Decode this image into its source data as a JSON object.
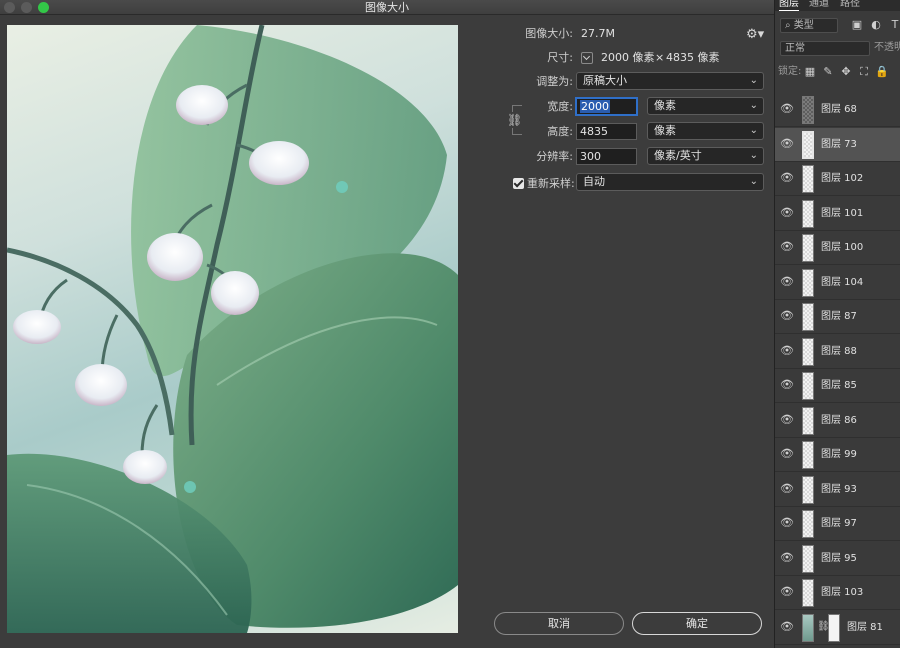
{
  "window": {
    "title": "图像大小"
  },
  "info": {
    "size_label": "图像大小:",
    "size_value": "27.7M",
    "dimensions_label": "尺寸:",
    "dimensions_w": "2000 像素",
    "dimensions_x": "×",
    "dimensions_h": "4835 像素"
  },
  "fit_to": {
    "label": "调整为:",
    "value": "原稿大小"
  },
  "width": {
    "label": "宽度:",
    "value": "2000",
    "unit": "像素"
  },
  "height": {
    "label": "高度:",
    "value": "4835",
    "unit": "像素"
  },
  "resolution": {
    "label": "分辨率:",
    "value": "300",
    "unit": "像素/英寸"
  },
  "resample": {
    "label": "重新采样:",
    "checked": true,
    "value": "自动"
  },
  "buttons": {
    "cancel": "取消",
    "ok": "确定"
  },
  "layers_panel": {
    "tabs": [
      "图层",
      "通道",
      "路径"
    ],
    "filter": "类型",
    "blend_mode": "正常",
    "opacity_label": "不透明",
    "lock_label": "锁定:",
    "layers": [
      {
        "name": "图层 68",
        "thumb": "dark"
      },
      {
        "name": "图层 73",
        "thumb": "selected",
        "selected": true
      },
      {
        "name": "图层 102",
        "thumb": "plain"
      },
      {
        "name": "图层 101",
        "thumb": "plain"
      },
      {
        "name": "图层 100",
        "thumb": "plain"
      },
      {
        "name": "图层 104",
        "thumb": "plain"
      },
      {
        "name": "图层 87",
        "thumb": "plain"
      },
      {
        "name": "图层 88",
        "thumb": "plain"
      },
      {
        "name": "图层 85",
        "thumb": "plain"
      },
      {
        "name": "图层 86",
        "thumb": "plain"
      },
      {
        "name": "图层 99",
        "thumb": "plain"
      },
      {
        "name": "图层 93",
        "thumb": "plain"
      },
      {
        "name": "图层 97",
        "thumb": "plain"
      },
      {
        "name": "图层 95",
        "thumb": "plain"
      },
      {
        "name": "图层 103",
        "thumb": "plain"
      },
      {
        "name": "图层 81",
        "thumb": "art",
        "mask": true
      }
    ]
  },
  "colors": {
    "accent": "#2f6fc8",
    "window_green": "#33c748",
    "dialog_bg": "#3c3c3c",
    "panel_bg": "#3a3a3a"
  }
}
